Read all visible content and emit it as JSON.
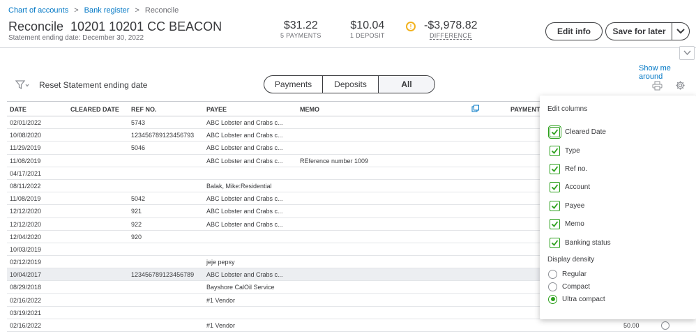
{
  "breadcrumb": {
    "items": [
      "Chart of accounts",
      "Bank register",
      "Reconcile"
    ],
    "sep": ">"
  },
  "header": {
    "title": "Reconcile  10201 10201 CC BEACON",
    "subtitle": "Statement ending date: December 30, 2022",
    "payments_amount": "$31.22",
    "payments_label": "5 PAYMENTS",
    "deposit_amount": "$10.04",
    "deposit_label": "1 DEPOSIT",
    "warn_glyph": "!",
    "difference_amount": "-$3,978.82",
    "difference_label": "DIFFERENCE",
    "edit_info": "Edit info",
    "save_for_later": "Save for later"
  },
  "help": {
    "show_me_around": "Show me around"
  },
  "toolbar": {
    "reset_label": "Reset Statement ending date",
    "tabs": [
      {
        "label": "Payments",
        "selected": false
      },
      {
        "label": "Deposits",
        "selected": false
      },
      {
        "label": "All",
        "selected": true
      }
    ]
  },
  "table": {
    "columns": [
      "DATE",
      "CLEARED DATE",
      "REF NO.",
      "PAYEE",
      "MEMO",
      "PAYMENT"
    ],
    "rows": [
      {
        "date": "02/01/2022",
        "ref": "5743",
        "payee": "ABC Lobster and Crabs c...",
        "memo": ""
      },
      {
        "date": "10/08/2020",
        "ref": "123456789123456793",
        "payee": "ABC Lobster and Crabs c...",
        "memo": ""
      },
      {
        "date": "11/29/2019",
        "ref": "5046",
        "payee": "ABC Lobster and Crabs c...",
        "memo": ""
      },
      {
        "date": "11/08/2019",
        "ref": "",
        "payee": "ABC Lobster and Crabs c...",
        "memo": "REference number 1009"
      },
      {
        "date": "04/17/2021",
        "ref": "",
        "payee": "",
        "memo": ""
      },
      {
        "date": "08/11/2022",
        "ref": "",
        "payee": "Balak, Mike:Residential",
        "memo": ""
      },
      {
        "date": "11/08/2019",
        "ref": "5042",
        "payee": "ABC Lobster and Crabs c...",
        "memo": ""
      },
      {
        "date": "12/12/2020",
        "ref": "921",
        "payee": "ABC Lobster and Crabs c...",
        "memo": ""
      },
      {
        "date": "12/12/2020",
        "ref": "922",
        "payee": "ABC Lobster and Crabs c...",
        "memo": ""
      },
      {
        "date": "12/04/2020",
        "ref": "920",
        "payee": "",
        "memo": ""
      },
      {
        "date": "10/03/2019",
        "ref": "",
        "payee": "",
        "memo": ""
      },
      {
        "date": "02/12/2019",
        "ref": "",
        "payee": "jeje pepsy",
        "memo": ""
      },
      {
        "date": "10/04/2017",
        "ref": "123456789123456789",
        "payee": "ABC Lobster and Crabs c...",
        "memo": ""
      },
      {
        "date": "08/29/2018",
        "ref": "",
        "payee": "Bayshore CalOil Service",
        "memo": ""
      },
      {
        "date": "02/16/2022",
        "ref": "",
        "payee": "#1 Vendor",
        "memo": ""
      },
      {
        "date": "03/19/2021",
        "ref": "",
        "payee": "",
        "memo": ""
      },
      {
        "date": "02/16/2022",
        "ref": "",
        "payee": "#1 Vendor",
        "memo": ""
      }
    ],
    "last_row_payment": "50.00"
  },
  "edit_columns": {
    "title": "Edit columns",
    "options": [
      "Cleared Date",
      "Type",
      "Ref no.",
      "Account",
      "Payee",
      "Memo",
      "Banking status"
    ],
    "density_title": "Display density",
    "density_options": [
      "Regular",
      "Compact",
      "Ultra compact"
    ],
    "density_selected": "Ultra compact"
  },
  "colors": {
    "link": "#0077c5",
    "accent_green": "#2ca01c",
    "warning": "#f2b21f"
  }
}
